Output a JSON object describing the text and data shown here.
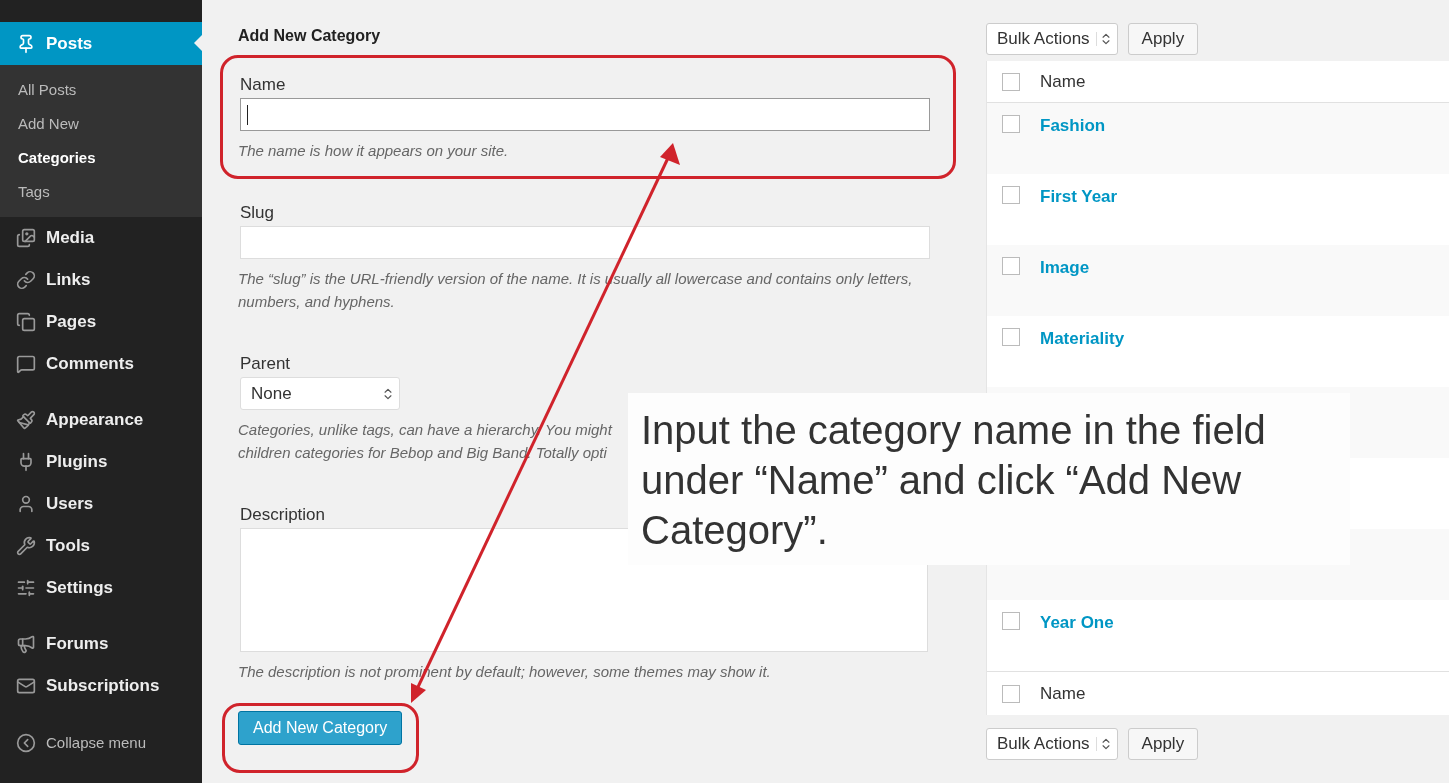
{
  "sidebar": {
    "groups": [
      [
        {
          "label": "Posts",
          "selected": true,
          "children": [
            {
              "label": "All Posts",
              "selected": false
            },
            {
              "label": "Add New",
              "selected": false
            },
            {
              "label": "Categories",
              "selected": true
            },
            {
              "label": "Tags",
              "selected": false
            }
          ]
        },
        {
          "label": "Media",
          "selected": false
        },
        {
          "label": "Links",
          "selected": false
        },
        {
          "label": "Pages",
          "selected": false
        },
        {
          "label": "Comments",
          "selected": false
        }
      ],
      [
        {
          "label": "Appearance",
          "selected": false
        },
        {
          "label": "Plugins",
          "selected": false
        },
        {
          "label": "Users",
          "selected": false
        },
        {
          "label": "Tools",
          "selected": false
        },
        {
          "label": "Settings",
          "selected": false
        }
      ],
      [
        {
          "label": "Forums",
          "selected": false
        },
        {
          "label": "Subscriptions",
          "selected": false
        }
      ]
    ],
    "collapse": "Collapse menu"
  },
  "form": {
    "heading": "Add New Category",
    "fields": [
      {
        "kind": "text",
        "label": "Name",
        "focused": true,
        "hint": "The name is how it appears on your site."
      },
      {
        "kind": "text",
        "label": "Slug",
        "focused": false,
        "hint": "The “slug” is the URL-friendly version of the name. It is usually all lowercase and contains only letters, numbers, and hyphens."
      },
      {
        "kind": "select",
        "label": "Parent",
        "value": "None",
        "hint_lines": [
          "Categories, unlike tags, can have a hierarchy. You might",
          "children categories for Bebop and Big Band. Totally opti"
        ]
      },
      {
        "kind": "textarea",
        "label": "Description",
        "focused": false,
        "hint": "The description is not prominent by default; however, some themes may show it."
      }
    ],
    "submit": "Add New Category"
  },
  "table": {
    "top_actions": {
      "select": "Bulk Actions",
      "button": "Apply"
    },
    "header": {
      "name": "Name",
      "checked": false
    },
    "rows": [
      {
        "name": "Fashion",
        "checked": false
      },
      {
        "name": "First Year",
        "checked": false
      },
      {
        "name": "Image",
        "checked": false
      },
      {
        "name": "Materiality",
        "checked": false
      },
      {},
      {},
      {},
      {
        "name": "Year One",
        "checked": false
      }
    ],
    "footer": {
      "name": "Name",
      "checked": false
    },
    "bottom_actions": {
      "select": "Bulk Actions",
      "button": "Apply"
    }
  },
  "callout": {
    "text": "Input the category name in the field under “Name” and click “Add New Category”."
  }
}
